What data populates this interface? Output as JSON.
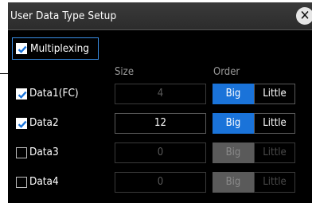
{
  "dialog": {
    "title": "User Data Type Setup",
    "close_icon": "close-icon",
    "multiplexing": {
      "label": "Multiplexing",
      "checked": true
    },
    "headers": {
      "size": "Size",
      "order": "Order"
    },
    "rows": [
      {
        "label": "Data1(FC)",
        "checked": true,
        "size": "4",
        "size_enabled": false,
        "order": "Big",
        "order_enabled": true
      },
      {
        "label": "Data2",
        "checked": true,
        "size": "12",
        "size_enabled": true,
        "order": "Big",
        "order_enabled": true
      },
      {
        "label": "Data3",
        "checked": false,
        "size": "0",
        "size_enabled": false,
        "order": "Big",
        "order_enabled": false
      },
      {
        "label": "Data4",
        "checked": false,
        "size": "0",
        "size_enabled": false,
        "order": "Big",
        "order_enabled": false
      }
    ],
    "order_options": [
      "Big",
      "Little"
    ],
    "colors": {
      "accent": "#1a73d9",
      "focus_border": "#3a8ee6",
      "background": "#000000"
    }
  }
}
